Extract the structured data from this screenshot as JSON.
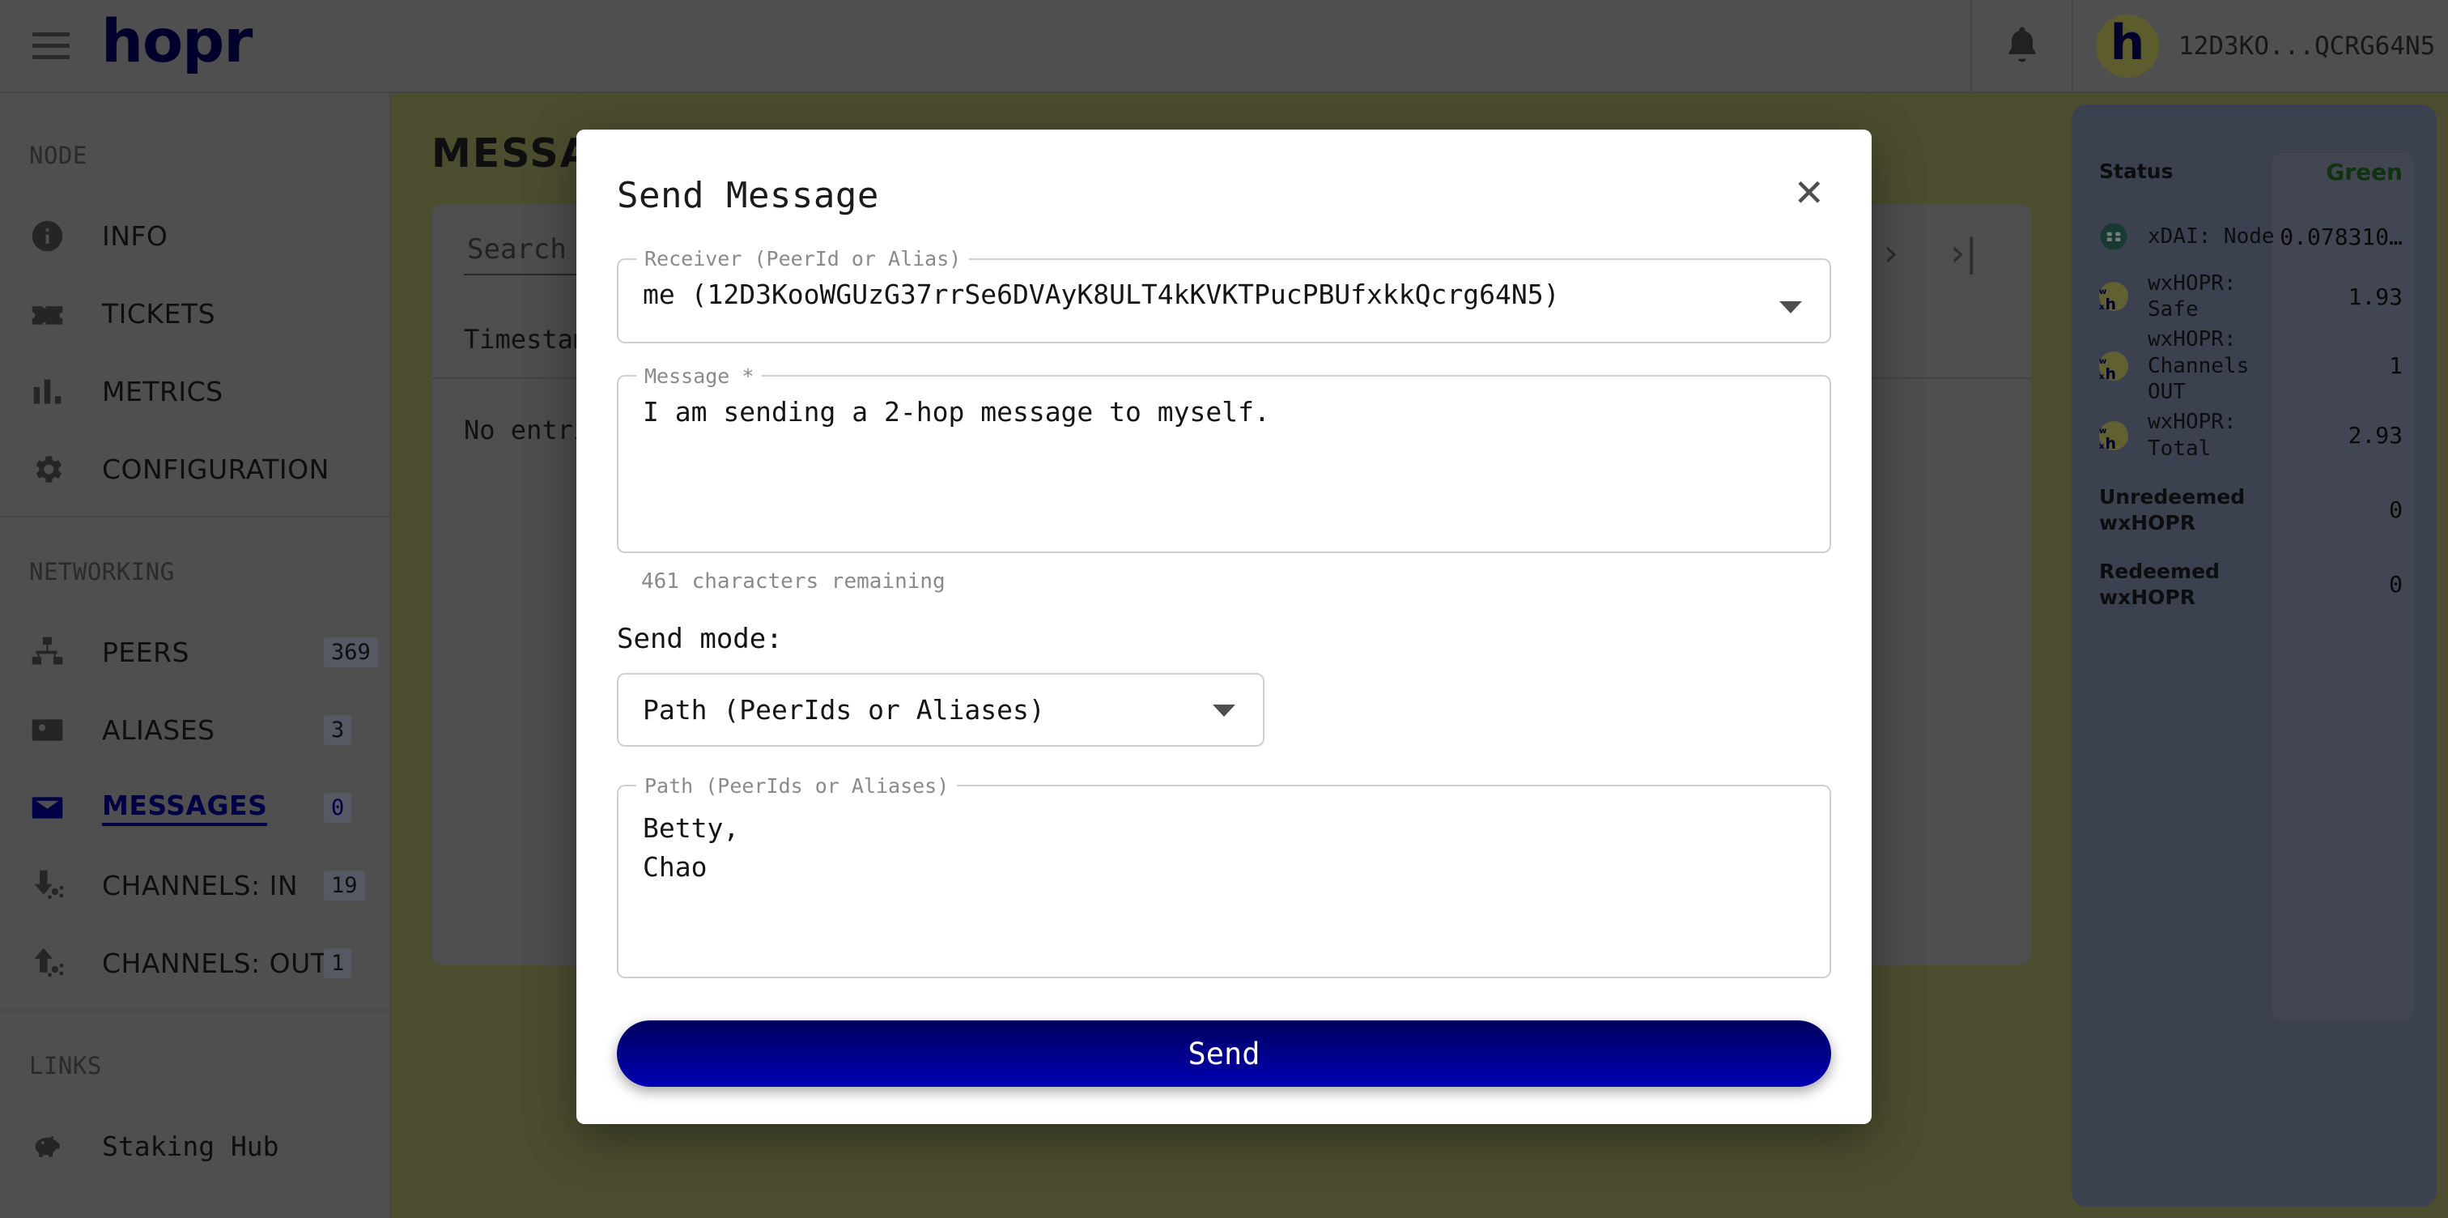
{
  "topbar": {
    "brand": "hopr",
    "menu_icon": "hamburger-icon",
    "bell_icon": "bell-icon",
    "node_avatar_letter": "h",
    "node_id_short": "12D3KO...QCRG64N5"
  },
  "sidebar": {
    "sections": [
      {
        "title": "NODE",
        "items": [
          {
            "label": "INFO",
            "icon": "info-icon",
            "badge": ""
          },
          {
            "label": "TICKETS",
            "icon": "ticket-icon",
            "badge": ""
          },
          {
            "label": "METRICS",
            "icon": "bar-chart-icon",
            "badge": ""
          },
          {
            "label": "CONFIGURATION",
            "icon": "gear-icon",
            "badge": ""
          }
        ]
      },
      {
        "title": "NETWORKING",
        "items": [
          {
            "label": "PEERS",
            "icon": "network-nodes-icon",
            "badge": "369"
          },
          {
            "label": "ALIASES",
            "icon": "contact-card-icon",
            "badge": "3"
          },
          {
            "label": "MESSAGES",
            "icon": "envelope-icon",
            "badge": "0"
          },
          {
            "label": "CHANNELS: IN",
            "icon": "arrow-down-channel-icon",
            "badge": "19"
          },
          {
            "label": "CHANNELS: OUT",
            "icon": "arrow-up-channel-icon",
            "badge": "1"
          }
        ]
      },
      {
        "title": "LINKS",
        "items": [
          {
            "label": "Staking Hub",
            "icon": "piggy-bank-icon",
            "badge": ""
          }
        ]
      }
    ],
    "active_label": "MESSAGES"
  },
  "main": {
    "page_title": "MESSAGES",
    "search_placeholder": "Search",
    "columns": [
      "Timestamp"
    ],
    "empty_text": "No entries",
    "pager": {
      "prev_icon": "chevron-left-icon",
      "next_icon": "chevron-right-icon",
      "last_icon": "chevron-last-icon"
    }
  },
  "infopanel": {
    "rows": [
      {
        "label": "Status",
        "value": "Green",
        "icon": "",
        "style": "green"
      },
      {
        "label": "xDAI: Node",
        "value": "0.078310…",
        "icon": "xdai-icon",
        "style": "mono"
      },
      {
        "label": "wxHOPR: Safe",
        "value": "1.93",
        "icon": "wxhopr-icon",
        "style": "mono"
      },
      {
        "label": "wxHOPR:\nChannels OUT",
        "value": "1",
        "icon": "wxhopr-icon",
        "style": "mono"
      },
      {
        "label": "wxHOPR:\nTotal",
        "value": "2.93",
        "icon": "wxhopr-icon",
        "style": "mono"
      },
      {
        "label": "Unredeemed\nwxHOPR",
        "value": "0",
        "icon": "",
        "style": "bold"
      },
      {
        "label": "Redeemed\nwxHOPR",
        "value": "0",
        "icon": "",
        "style": "bold"
      }
    ]
  },
  "modal": {
    "title": "Send Message",
    "close_icon": "close-icon",
    "receiver": {
      "legend": "Receiver (PeerId or Alias)",
      "value": "me (12D3KooWGUzG37rrSe6DVAyK8ULT4kKVKTPucPBUfxkkQcrg64N5)"
    },
    "message": {
      "legend": "Message *",
      "value": "I am sending a 2-hop message to myself."
    },
    "char_remaining": "461 characters remaining",
    "send_mode": {
      "label": "Send mode:",
      "selected": "Path (PeerIds or Aliases)"
    },
    "path": {
      "legend": "Path (PeerIds or Aliases)",
      "value": "Betty,\nChao"
    },
    "send_button": "Send"
  }
}
